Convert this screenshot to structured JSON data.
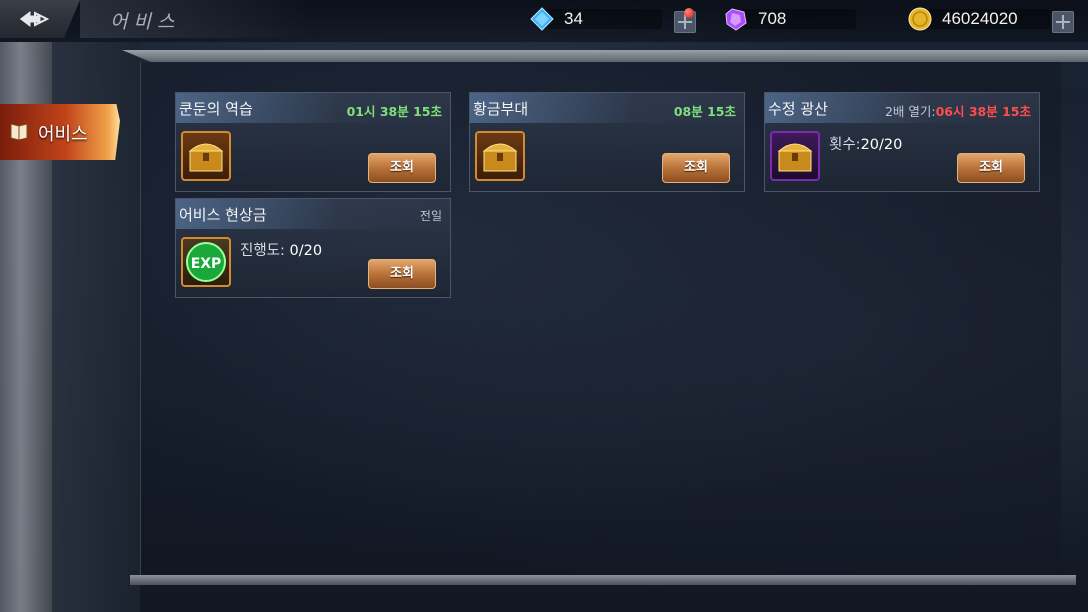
{
  "header": {
    "title": "어비스",
    "back_icon": "back-arrow-icon"
  },
  "currencies": [
    {
      "icon": "blue-diamond-icon",
      "value": "34",
      "color": "#3fb8ff"
    },
    {
      "icon": "purple-crystal-icon",
      "value": "708",
      "color": "#b85cff"
    },
    {
      "icon": "gold-coin-icon",
      "value": "46024020",
      "color": "#e8b52a"
    }
  ],
  "sidebar": {
    "tab_label": "어비스",
    "tab_icon": "book-icon"
  },
  "cards": [
    {
      "title": "쿤둔의 역습",
      "timer": "01시 38분 15초",
      "timer_color": "#7ee07a",
      "icon": "golden-chest-icon",
      "button": "조회"
    },
    {
      "title": "황금부대",
      "timer": "08분 15초",
      "timer_color": "#7ee07a",
      "icon": "golden-chest-icon",
      "button": "조회"
    },
    {
      "title": "수정 광산",
      "unlock_label": "2배 열기:",
      "timer": "06시 38분 15초",
      "timer_color": "#ff4d4d",
      "icon": "golden-chest-icon",
      "info_label": "횟수:",
      "info_value": "20/20",
      "button": "조회"
    },
    {
      "title": "어비스 현상금",
      "note": "전일",
      "icon": "exp-orb-icon",
      "info_label": "진행도:",
      "info_value": "0/20",
      "button": "조회"
    }
  ]
}
